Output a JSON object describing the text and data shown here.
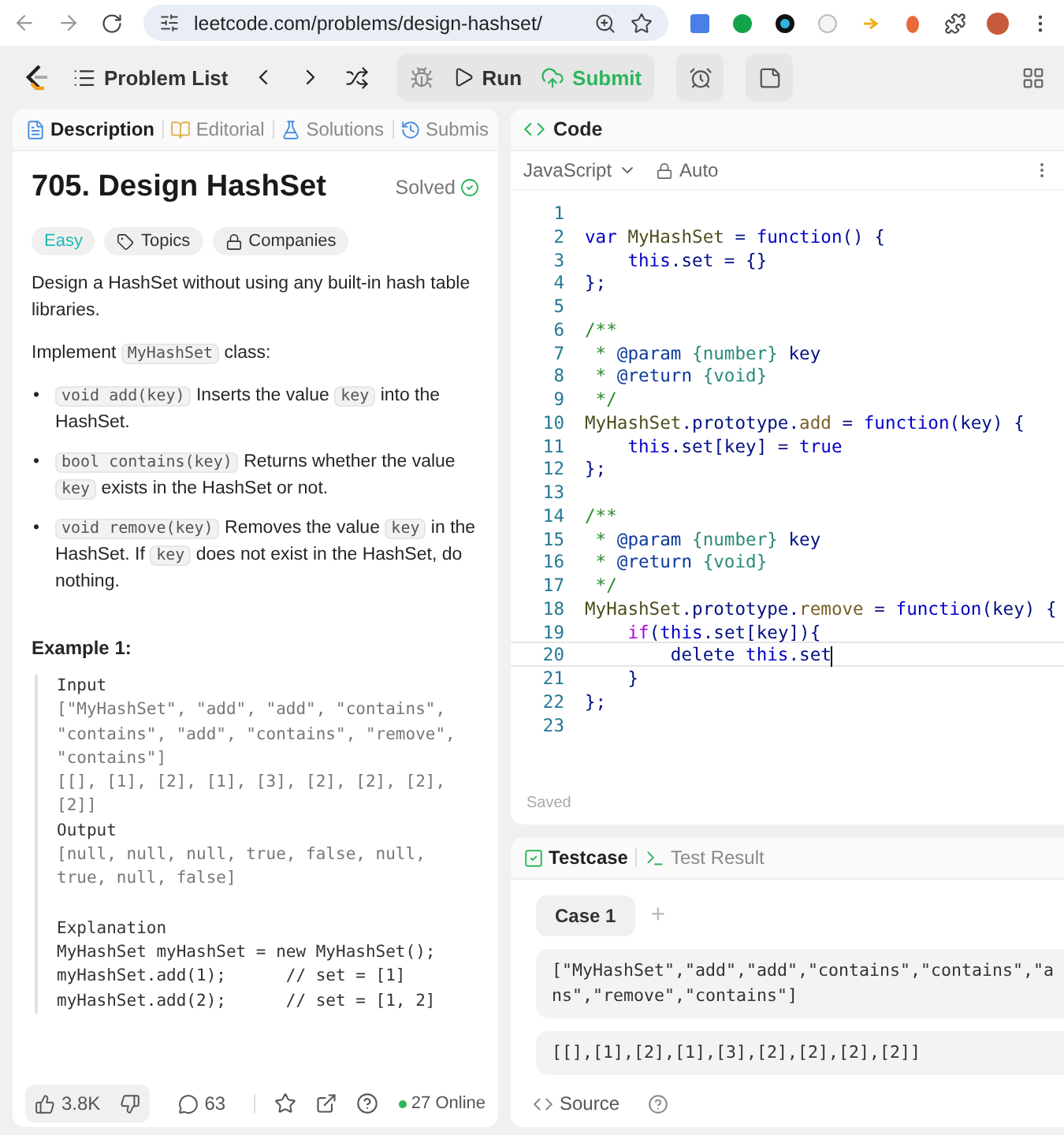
{
  "browser": {
    "url": "leetcode.com/problems/design-hashset/"
  },
  "topbar": {
    "problem_list": "Problem List",
    "run": "Run",
    "submit": "Submit"
  },
  "left_tabs": [
    {
      "label": "Description",
      "selected": true,
      "kind": "description"
    },
    {
      "label": "Editorial",
      "selected": false,
      "kind": "editorial"
    },
    {
      "label": "Solutions",
      "selected": false,
      "kind": "solutions"
    },
    {
      "label": "Submis",
      "selected": false,
      "kind": "submissions"
    }
  ],
  "problem": {
    "title": "705. Design HashSet",
    "status": "Solved",
    "bullet": "•",
    "tags": [
      {
        "label": "Easy",
        "kind": "difficulty"
      },
      {
        "label": "Topics",
        "kind": "topics"
      },
      {
        "label": "Companies",
        "kind": "companies"
      }
    ],
    "paragraphs": [
      [
        {
          "kind": "text",
          "text": "Design a HashSet without using any built-in hash table libraries."
        }
      ],
      [
        {
          "kind": "text",
          "text": "Implement "
        },
        {
          "kind": "code",
          "text": "MyHashSet"
        },
        {
          "kind": "text",
          "text": " class:"
        }
      ]
    ],
    "bullets": [
      [
        {
          "kind": "code",
          "text": "void add(key)"
        },
        {
          "kind": "text",
          "text": " Inserts the value "
        },
        {
          "kind": "code",
          "text": "key"
        },
        {
          "kind": "text",
          "text": " into the HashSet."
        }
      ],
      [
        {
          "kind": "code",
          "text": "bool contains(key)"
        },
        {
          "kind": "text",
          "text": " Returns whether the value "
        },
        {
          "kind": "code",
          "text": "key"
        },
        {
          "kind": "text",
          "text": " exists in the HashSet or not."
        }
      ],
      [
        {
          "kind": "code",
          "text": "void remove(key)"
        },
        {
          "kind": "text",
          "text": " Removes the value "
        },
        {
          "kind": "code",
          "text": "key"
        },
        {
          "kind": "text",
          "text": " in the HashSet. If "
        },
        {
          "kind": "code",
          "text": "key"
        },
        {
          "kind": "text",
          "text": " does not exist in the HashSet, do nothing."
        }
      ]
    ],
    "example": {
      "heading": "Example 1:",
      "lines": [
        {
          "kind": "label",
          "text": "Input"
        },
        {
          "kind": "value",
          "text": "[\"MyHashSet\", \"add\", \"add\", \"contains\","
        },
        {
          "kind": "value",
          "text": "\"contains\", \"add\", \"contains\", \"remove\","
        },
        {
          "kind": "value",
          "text": "\"contains\"]"
        },
        {
          "kind": "value",
          "text": "[[], [1], [2], [1], [3], [2], [2], [2],"
        },
        {
          "kind": "value",
          "text": "[2]]"
        },
        {
          "kind": "label",
          "text": "Output"
        },
        {
          "kind": "value",
          "text": "[null, null, null, true, false, null,"
        },
        {
          "kind": "value",
          "text": "true, null, false]"
        },
        {
          "kind": "section",
          "text": "Explanation"
        },
        {
          "kind": "code",
          "text": "MyHashSet myHashSet = new MyHashSet();"
        },
        {
          "kind": "code",
          "text": "myHashSet.add(1);      // set = [1]"
        },
        {
          "kind": "code",
          "text": "myHashSet.add(2);      // set = [1, 2]"
        }
      ]
    }
  },
  "footer": {
    "likes": "3.8K",
    "comments": "63",
    "online": "27 Online"
  },
  "code_panel": {
    "title": "Code",
    "language": "JavaScript",
    "mode": "Auto",
    "saved": "Saved",
    "lines": [
      {
        "n": "1",
        "current": false
      },
      {
        "n": "2",
        "current": false,
        "tokens": [
          {
            "kind": "kw",
            "text": "var"
          },
          {
            "kind": "cls",
            "text": " MyHashSet"
          },
          {
            "kind": "p",
            "text": " ="
          },
          {
            "kind": "kw",
            "text": " function"
          },
          {
            "kind": "p",
            "text": "() {"
          }
        ]
      },
      {
        "n": "3",
        "current": false,
        "tokens": [
          {
            "kind": "kw",
            "text": "    this"
          },
          {
            "kind": "p",
            "text": ".set = {}"
          }
        ]
      },
      {
        "n": "4",
        "current": false,
        "tokens": [
          {
            "kind": "p",
            "text": "};"
          }
        ]
      },
      {
        "n": "5",
        "current": false
      },
      {
        "n": "6",
        "current": false,
        "tokens": [
          {
            "kind": "cm",
            "text": "/**"
          }
        ]
      },
      {
        "n": "7",
        "current": false,
        "tokens": [
          {
            "kind": "cm",
            "text": " *"
          },
          {
            "kind": "tag",
            "text": " @param"
          },
          {
            "kind": "ty",
            "text": " {number}"
          },
          {
            "kind": "p",
            "text": " key"
          }
        ]
      },
      {
        "n": "8",
        "current": false,
        "tokens": [
          {
            "kind": "cm",
            "text": " *"
          },
          {
            "kind": "tag",
            "text": " @return"
          },
          {
            "kind": "ty",
            "text": " {void}"
          }
        ]
      },
      {
        "n": "9",
        "current": false,
        "tokens": [
          {
            "kind": "cm",
            "text": " */"
          }
        ]
      },
      {
        "n": "10",
        "current": false,
        "tokens": [
          {
            "kind": "cls",
            "text": "MyHashSet"
          },
          {
            "kind": "p",
            "text": ".prototype."
          },
          {
            "kind": "fn",
            "text": "add"
          },
          {
            "kind": "p",
            "text": " ="
          },
          {
            "kind": "kw",
            "text": " function"
          },
          {
            "kind": "p",
            "text": "(key) {"
          }
        ]
      },
      {
        "n": "11",
        "current": false,
        "tokens": [
          {
            "kind": "kw",
            "text": "    this"
          },
          {
            "kind": "p",
            "text": ".set[key] ="
          },
          {
            "kind": "kw",
            "text": " true"
          }
        ]
      },
      {
        "n": "12",
        "current": false,
        "tokens": [
          {
            "kind": "p",
            "text": "};"
          }
        ]
      },
      {
        "n": "13",
        "current": false
      },
      {
        "n": "14",
        "current": false,
        "tokens": [
          {
            "kind": "cm",
            "text": "/**"
          }
        ]
      },
      {
        "n": "15",
        "current": false,
        "tokens": [
          {
            "kind": "cm",
            "text": " *"
          },
          {
            "kind": "tag",
            "text": " @param"
          },
          {
            "kind": "ty",
            "text": " {number}"
          },
          {
            "kind": "p",
            "text": " key"
          }
        ]
      },
      {
        "n": "16",
        "current": false,
        "tokens": [
          {
            "kind": "cm",
            "text": " *"
          },
          {
            "kind": "tag",
            "text": " @return"
          },
          {
            "kind": "ty",
            "text": " {void}"
          }
        ]
      },
      {
        "n": "17",
        "current": false,
        "tokens": [
          {
            "kind": "cm",
            "text": " */"
          }
        ]
      },
      {
        "n": "18",
        "current": false,
        "tokens": [
          {
            "kind": "cls",
            "text": "MyHashSet"
          },
          {
            "kind": "p",
            "text": ".prototype."
          },
          {
            "kind": "fn",
            "text": "remove"
          },
          {
            "kind": "p",
            "text": " ="
          },
          {
            "kind": "kw",
            "text": " function"
          },
          {
            "kind": "p",
            "text": "(key) {"
          }
        ]
      },
      {
        "n": "19",
        "current": false,
        "tokens": [
          {
            "kind": "ctl",
            "text": "    if"
          },
          {
            "kind": "p",
            "text": "("
          },
          {
            "kind": "kw",
            "text": "this"
          },
          {
            "kind": "p",
            "text": ".set[key]){"
          }
        ]
      },
      {
        "n": "20",
        "current": true,
        "tokens": [
          {
            "kind": "p",
            "text": "        delete"
          },
          {
            "kind": "kw",
            "text": " this"
          },
          {
            "kind": "p",
            "text": ".set"
          }
        ]
      },
      {
        "n": "21",
        "current": false,
        "tokens": [
          {
            "kind": "p",
            "text": "    }"
          }
        ]
      },
      {
        "n": "22",
        "current": false,
        "tokens": [
          {
            "kind": "p",
            "text": "};"
          }
        ]
      },
      {
        "n": "23",
        "current": false
      }
    ]
  },
  "testcase": {
    "tabs": [
      {
        "label": "Testcase",
        "selected": true,
        "kind": "testcase"
      },
      {
        "label": "Test Result",
        "selected": false,
        "kind": "result"
      }
    ],
    "cases": [
      {
        "label": "Case 1",
        "selected": true
      }
    ],
    "add": "+",
    "inputs": [
      [
        "[\"MyHashSet\",\"add\",\"add\",\"contains\",\"contains\",\"a",
        "ns\",\"remove\",\"contains\"]"
      ],
      [
        "[[],[1],[2],[1],[3],[2],[2],[2],[2]]"
      ]
    ],
    "source": "Source"
  }
}
